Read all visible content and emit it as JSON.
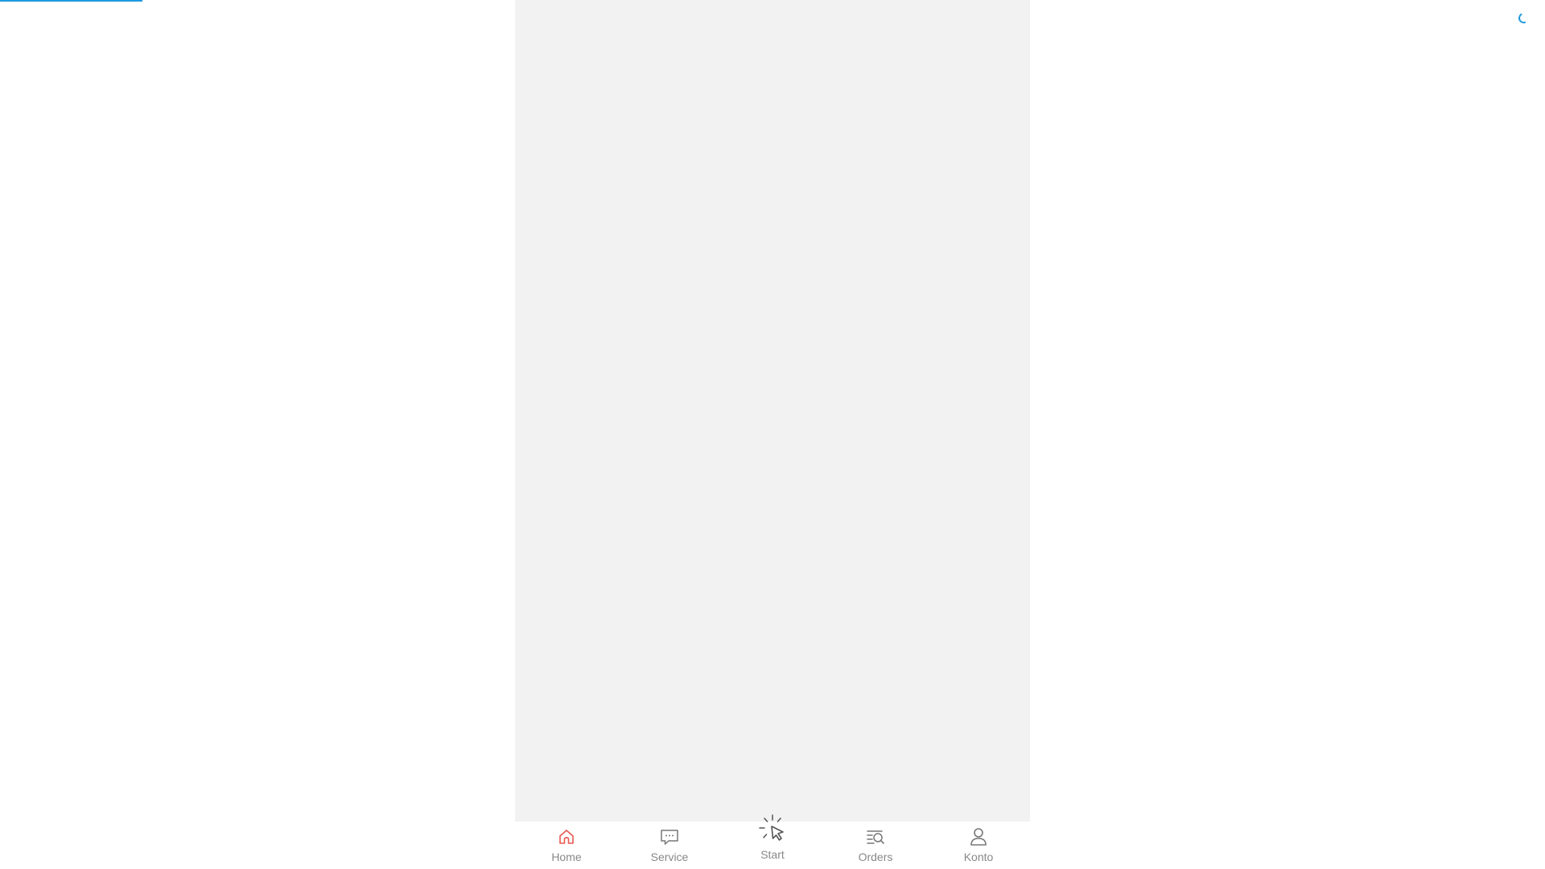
{
  "loading": {
    "progress_fraction": 0.092,
    "spinner": "loading-spinner-icon",
    "accent_color": "#1e9ae0"
  },
  "colors": {
    "app_background": "#f2f2f2",
    "tab_active": "#e8584f",
    "tab_inactive": "#888888",
    "icon_inactive": "#777777"
  },
  "tabbar": {
    "tabs": [
      {
        "label": "Home",
        "icon": "home-icon",
        "active": true
      },
      {
        "label": "Service",
        "icon": "chat-bubble-icon",
        "active": false
      },
      {
        "label": "Start",
        "icon": "click-pointer-icon",
        "active": false
      },
      {
        "label": "Orders",
        "icon": "order-search-icon",
        "active": false
      },
      {
        "label": "Konto",
        "icon": "user-icon",
        "active": false
      }
    ]
  }
}
